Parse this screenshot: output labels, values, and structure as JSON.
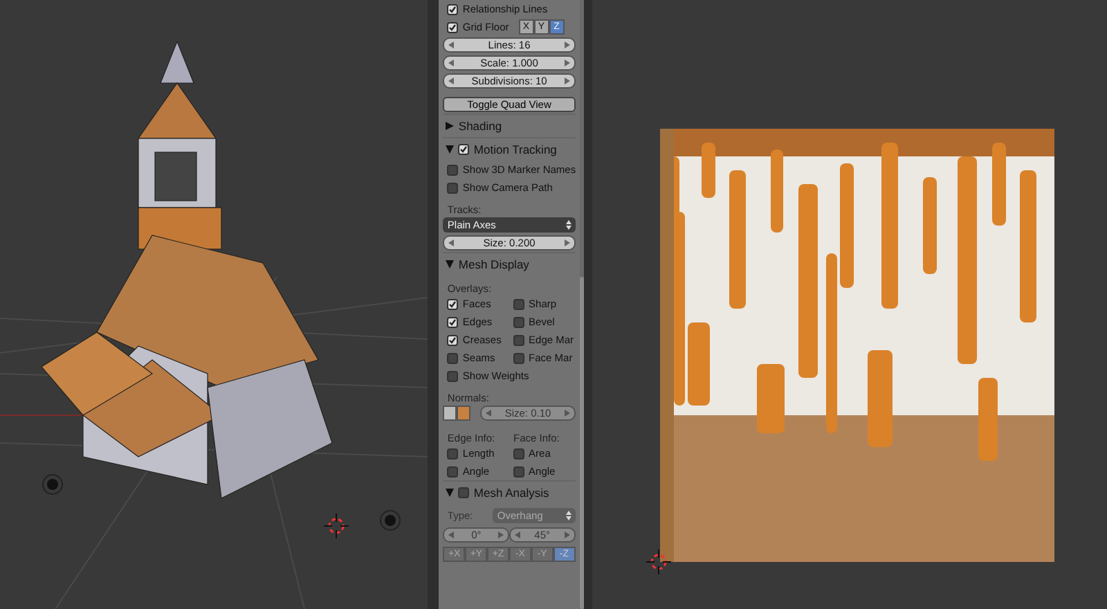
{
  "panel": {
    "rows": [
      {
        "kind": "check",
        "label": "Relationship Lines",
        "checked": true
      },
      {
        "kind": "gridfloor",
        "label": "Grid Floor",
        "checked": true,
        "axes": [
          {
            "label": "X",
            "selected": false
          },
          {
            "label": "Y",
            "selected": false
          },
          {
            "label": "Z",
            "selected": true
          }
        ]
      },
      {
        "kind": "number",
        "text": "Lines: 16",
        "disabled": false
      },
      {
        "kind": "number",
        "text": "Scale: 1.000",
        "disabled": false
      },
      {
        "kind": "number",
        "text": "Subdivisions: 10",
        "disabled": false
      },
      {
        "kind": "button",
        "label": "Toggle Quad View"
      },
      {
        "kind": "header",
        "label": "Shading",
        "expanded": false
      },
      {
        "kind": "header",
        "label": "Motion Tracking",
        "expanded": true,
        "checked": true
      },
      {
        "kind": "check",
        "label": "Show 3D Marker Names",
        "checked": false
      },
      {
        "kind": "check",
        "label": "Show Camera Path",
        "checked": false
      },
      {
        "kind": "label",
        "text": "Tracks:"
      },
      {
        "kind": "dropdown",
        "value": "Plain Axes"
      },
      {
        "kind": "number",
        "text": "Size: 0.200",
        "disabled": false
      },
      {
        "kind": "header",
        "label": "Mesh Display",
        "expanded": true
      },
      {
        "kind": "label",
        "text": "Overlays:"
      },
      {
        "kind": "checkpair",
        "items": [
          {
            "label": "Faces",
            "checked": true
          },
          {
            "label": "Sharp",
            "checked": false
          }
        ]
      },
      {
        "kind": "checkpair",
        "items": [
          {
            "label": "Edges",
            "checked": true
          },
          {
            "label": "Bevel",
            "checked": false
          }
        ]
      },
      {
        "kind": "checkpair",
        "items": [
          {
            "label": "Creases",
            "checked": true
          },
          {
            "label": "Edge Mar",
            "checked": false
          }
        ]
      },
      {
        "kind": "checkpair",
        "items": [
          {
            "label": "Seams",
            "checked": false
          },
          {
            "label": "Face Mar",
            "checked": false
          }
        ]
      },
      {
        "kind": "check",
        "label": "Show Weights",
        "checked": false
      },
      {
        "kind": "label",
        "text": "Normals:"
      },
      {
        "kind": "normals",
        "text": "Size: 0.10",
        "disabled": true
      },
      {
        "kind": "labelpair",
        "items": [
          "Edge Info:",
          "Face Info:"
        ]
      },
      {
        "kind": "checkpair",
        "items": [
          {
            "label": "Length",
            "checked": false
          },
          {
            "label": "Area",
            "checked": false
          }
        ]
      },
      {
        "kind": "checkpair",
        "items": [
          {
            "label": "Angle",
            "checked": false
          },
          {
            "label": "Angle",
            "checked": false
          }
        ]
      },
      {
        "kind": "header",
        "label": "Mesh Analysis",
        "expanded": true,
        "checked": false
      },
      {
        "kind": "typedrop",
        "label": "Type:",
        "value": "Overhang",
        "disabled": true
      },
      {
        "kind": "range",
        "values": [
          "0°",
          "45°"
        ],
        "disabled": true
      },
      {
        "kind": "axisbuttons",
        "items": [
          {
            "label": "+X",
            "selected": false
          },
          {
            "label": "+Y",
            "selected": false
          },
          {
            "label": "+Z",
            "selected": false
          },
          {
            "label": "-X",
            "selected": false
          },
          {
            "label": "-Y",
            "selected": false
          },
          {
            "label": "-Z",
            "selected": true
          }
        ]
      }
    ]
  }
}
